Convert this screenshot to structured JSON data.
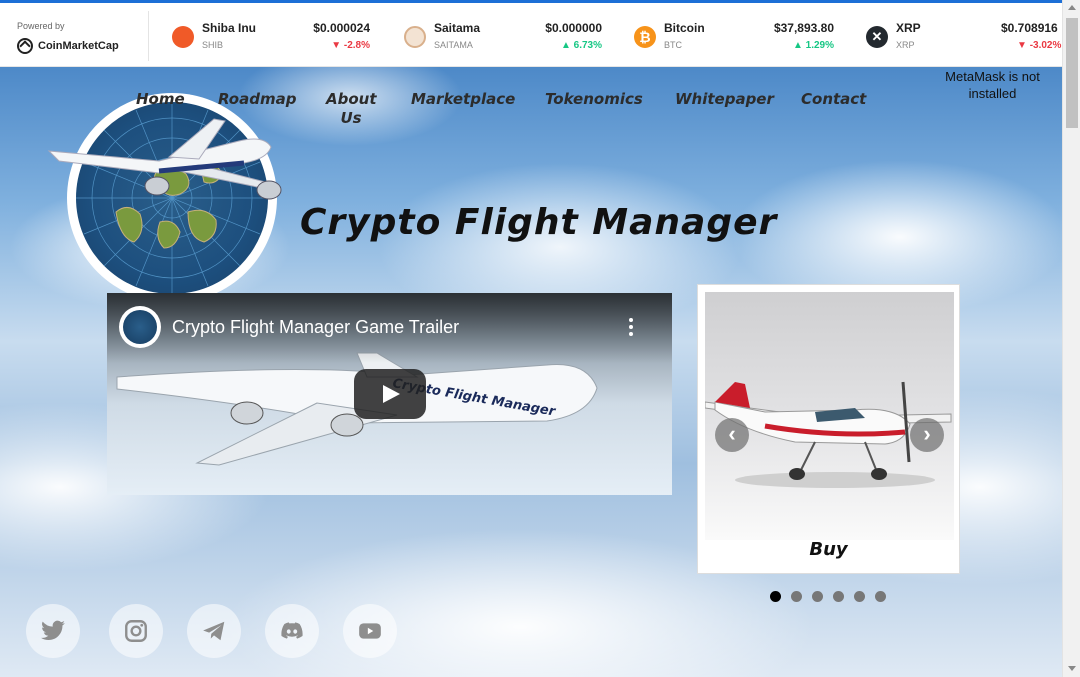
{
  "ticker": {
    "powered_by": "Powered by",
    "brand": "CoinMarketCap",
    "coins": [
      {
        "name": "Shiba Inu",
        "symbol": "SHIB",
        "price": "$0.000024",
        "change": "-2.8%",
        "direction": "down",
        "icon": "shiba-icon",
        "color": "#f05a28"
      },
      {
        "name": "Saitama",
        "symbol": "SAITAMA",
        "price": "$0.000000",
        "change": "6.73%",
        "direction": "up",
        "icon": "saitama-icon",
        "color": "#d9b08c"
      },
      {
        "name": "Bitcoin",
        "symbol": "BTC",
        "price": "$37,893.80",
        "change": "1.29%",
        "direction": "up",
        "icon": "bitcoin-icon",
        "color": "#f7931a"
      },
      {
        "name": "XRP",
        "symbol": "XRP",
        "price": "$0.708916",
        "change": "-3.02%",
        "direction": "down",
        "icon": "xrp-icon",
        "color": "#23292f"
      }
    ]
  },
  "nav": {
    "home": "Home",
    "roadmap": "Roadmap",
    "about": "About Us",
    "marketplace": "Marketplace",
    "tokenomics": "Tokenomics",
    "whitepaper": "Whitepaper",
    "contact": "Contact"
  },
  "metamask_status": "MetaMask is not installed",
  "hero": {
    "title": "Crypto Flight Manager"
  },
  "video": {
    "title": "Crypto Flight Manager Game Trailer",
    "plane_livery": "Crypto Flight Manager"
  },
  "carousel": {
    "button": "Buy",
    "slide_count": 6,
    "active_slide": 1,
    "prev": "‹",
    "next": "›"
  },
  "social": [
    "twitter-icon",
    "instagram-icon",
    "telegram-icon",
    "discord-icon",
    "youtube-icon"
  ]
}
